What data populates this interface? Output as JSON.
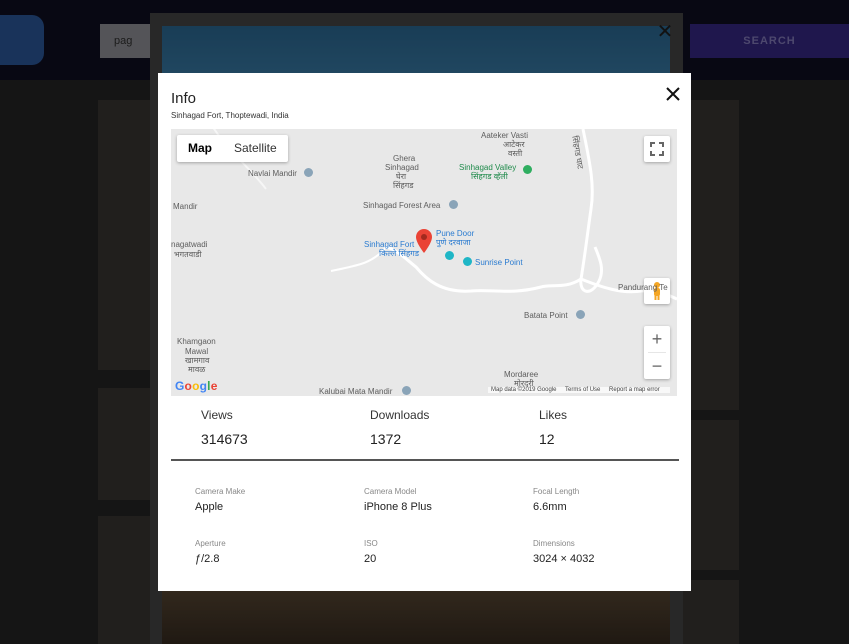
{
  "background": {
    "search_text": "pag",
    "search_button": "SEARCH",
    "close_glyph": "✕"
  },
  "modal": {
    "title": "Info",
    "location": "Sinhagad Fort, Thoptewadi, India",
    "close_icon": "close-icon"
  },
  "map": {
    "type_buttons": [
      "Map",
      "Satellite"
    ],
    "active_type": "Map",
    "zoom_in": "+",
    "zoom_out": "−",
    "google_logo": "Google",
    "footer": [
      "Map data ©2019 Google",
      "Terms of Use",
      "Report a map error"
    ],
    "places": {
      "aateker_vasti": "Aateker Vasti",
      "aateker_vasti_mr": "आटेकर",
      "aateker_vasti_mr2": "वस्ती",
      "ghera_sinhagad": "Ghera",
      "ghera_sinhagad2": "Sinhagad",
      "ghera_mr": "घेरा",
      "ghera_mr2": "सिंहगड",
      "navlai_mandir": "Navlai Mandir",
      "sinhagad_valley": "Sinhagad Valley",
      "sinhagad_valley_mr": "सिंहगड व्हॅली",
      "mandir": "Mandir",
      "sinhagad_forest_area": "Sinhagad Forest Area",
      "pune_door": "Pune Door",
      "pune_door_mr": "पुणे दरवाजा",
      "sinhagad_fort": "Sinhagad Fort",
      "sinhagad_fort_mr": "किल्ले सिंहगड",
      "sunrise_point": "Sunrise Point",
      "nagatwadi": "nagatwadi",
      "nagatwadi_mr": "भगतवाडी",
      "pandurang": "Pandurang Te",
      "batata_point": "Batata Point",
      "khamgaon_mawal": "Khamgaon",
      "khamgaon_mawal2": "Mawal",
      "khamgaon_mr": "खामगाव",
      "khamgaon_mr2": "मावळ",
      "mordaree": "Mordaree",
      "mordaree_mr": "मोरदरी",
      "kalubai_mata_mandir": "Kalubai Mata Mandir",
      "road_mr": "सिंहगड घाट"
    }
  },
  "stats": [
    {
      "label": "Views",
      "value": "314673"
    },
    {
      "label": "Downloads",
      "value": "1372"
    },
    {
      "label": "Likes",
      "value": "12"
    }
  ],
  "exif": [
    {
      "label": "Camera Make",
      "value": "Apple"
    },
    {
      "label": "Camera Model",
      "value": "iPhone 8 Plus"
    },
    {
      "label": "Focal Length",
      "value": "6.6mm"
    },
    {
      "label": "Aperture",
      "value": "ƒ/2.8"
    },
    {
      "label": "ISO",
      "value": "20"
    },
    {
      "label": "Dimensions",
      "value": "3024 × 4032"
    }
  ],
  "colors": {
    "marker": "#ea4335",
    "map_bg": "#e8e8e8",
    "park": "#2fae60",
    "link": "#2a7bd0"
  }
}
